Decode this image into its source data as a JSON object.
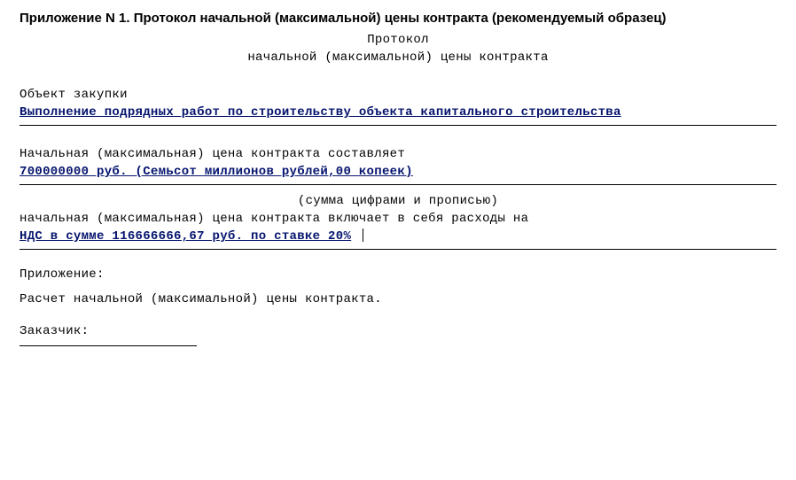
{
  "doc": {
    "title": "Приложение N 1. Протокол начальной (максимальной) цены контракта (рекомендуемый образец)",
    "heading_line1": "Протокол",
    "heading_line2": "начальной  (максимальной)  цены контракта",
    "subject_label": "Объект закупки",
    "subject_value": "Выполнение подрядных работ по строительству объекта капитального строительства",
    "nmck_intro": "Начальная  (максимальная)  цена  контракта  составляет",
    "nmck_value": "700000000 руб. (Семьсот миллионов рублей,00 копеек)",
    "sum_hint": "(сумма цифрами и прописью)",
    "includes_line": "начальная  (максимальная)  цена  контракта  включает  в  себя  расходы  на",
    "vat_value": "НДС в сумме 116666666,67 руб. по ставке 20%",
    "attachment_label": "Приложение:",
    "attachment_text": "Расчет начальной (максимальной) цены контракта.",
    "customer_label": "Заказчик:"
  }
}
